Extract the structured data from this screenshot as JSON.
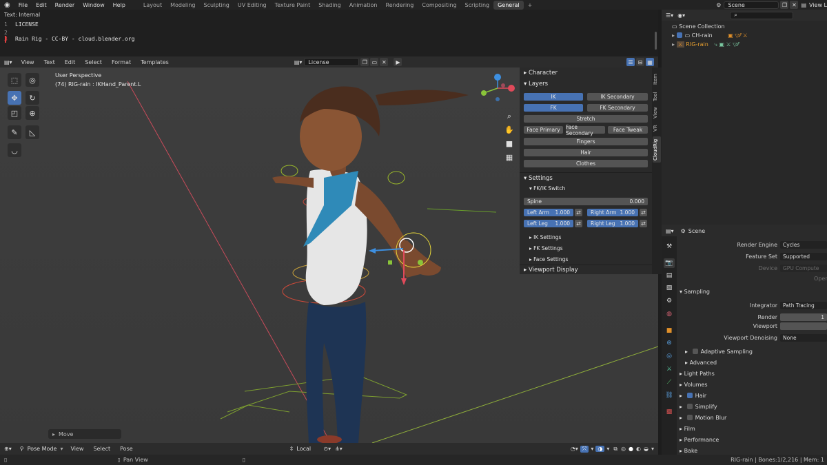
{
  "topbar": {
    "menus": [
      "File",
      "Edit",
      "Render",
      "Window",
      "Help"
    ],
    "workspaces": [
      "Layout",
      "Modeling",
      "Sculpting",
      "UV Editing",
      "Texture Paint",
      "Shading",
      "Animation",
      "Rendering",
      "Compositing",
      "Scripting",
      "General"
    ],
    "active_workspace": "General",
    "add_tab": "+",
    "scene": "Scene",
    "view_layer": "View L"
  },
  "text_editor": {
    "title": "Text: Internal",
    "lines": [
      {
        "num": "1",
        "text": "LICENSE"
      },
      {
        "num": "2",
        "text": ""
      },
      {
        "num": "3",
        "text": "Rain Rig - CC-BY - cloud.blender.org"
      }
    ],
    "menus": [
      "View",
      "Text",
      "Edit",
      "Select",
      "Format",
      "Templates"
    ],
    "datablock": "License"
  },
  "viewport": {
    "perspective": "User Perspective",
    "object": "(74) RIG-rain : IKHand_Parent.L",
    "last_op": "Move",
    "mode": "Pose Mode",
    "menus": [
      "View",
      "Select",
      "Pose"
    ],
    "transform_orientation": "Local",
    "colors": {
      "x_axis": "#e04a5a",
      "y_axis": "#8ac43a",
      "z_axis": "#3d8fe0",
      "active": "#4772b3"
    }
  },
  "npanel": {
    "character": "Character",
    "layers": "Layers",
    "buttons": {
      "ik": "IK",
      "ik_secondary": "IK Secondary",
      "fk": "FK",
      "fk_secondary": "FK Secondary",
      "stretch": "Stretch",
      "face_primary": "Face Primary",
      "face_secondary": "Face Secondary",
      "face_tweak": "Face Tweak",
      "fingers": "Fingers",
      "hair": "Hair",
      "clothes": "Clothes"
    },
    "settings": "Settings",
    "fkik_switch": "FK/IK Switch",
    "spine": {
      "label": "Spine",
      "value": "0.000"
    },
    "left_arm": {
      "label": "Left Arm",
      "value": "1.000"
    },
    "right_arm": {
      "label": "Right Arm",
      "value": "1.000"
    },
    "left_leg": {
      "label": "Left Leg",
      "value": "1.000"
    },
    "right_leg": {
      "label": "Right Leg",
      "value": "1.000"
    },
    "ik_settings": "IK Settings",
    "fk_settings": "FK Settings",
    "face_settings": "Face Settings",
    "viewport_display": "Viewport Display",
    "tabs": [
      "Item",
      "Tool",
      "View",
      "VR",
      "CloudRig"
    ]
  },
  "outliner": {
    "root": "Scene Collection",
    "items": [
      "CH-rain",
      "RIG-rain"
    ]
  },
  "properties": {
    "scene": "Scene",
    "render_engine": {
      "label": "Render Engine",
      "value": "Cycles"
    },
    "feature_set": {
      "label": "Feature Set",
      "value": "Supported"
    },
    "device": {
      "label": "Device",
      "value": "GPU Compute"
    },
    "open": "Open",
    "sampling": "Sampling",
    "integrator": {
      "label": "Integrator",
      "value": "Path Tracing"
    },
    "render": {
      "label": "Render",
      "value": "1"
    },
    "viewport": {
      "label": "Viewport",
      "value": ""
    },
    "viewport_denoising": {
      "label": "Viewport Denoising",
      "value": "None"
    },
    "adaptive_sampling": "Adaptive Sampling",
    "advanced": "Advanced",
    "sections": {
      "light_paths": "Light Paths",
      "volumes": "Volumes",
      "hair": "Hair",
      "simplify": "Simplify",
      "motion_blur": "Motion Blur",
      "film": "Film",
      "performance": "Performance",
      "bake": "Bake"
    }
  },
  "status": {
    "pan_view": "Pan View",
    "stats": "RIG-rain | Bones:1/2,216 | Mem: 1"
  }
}
